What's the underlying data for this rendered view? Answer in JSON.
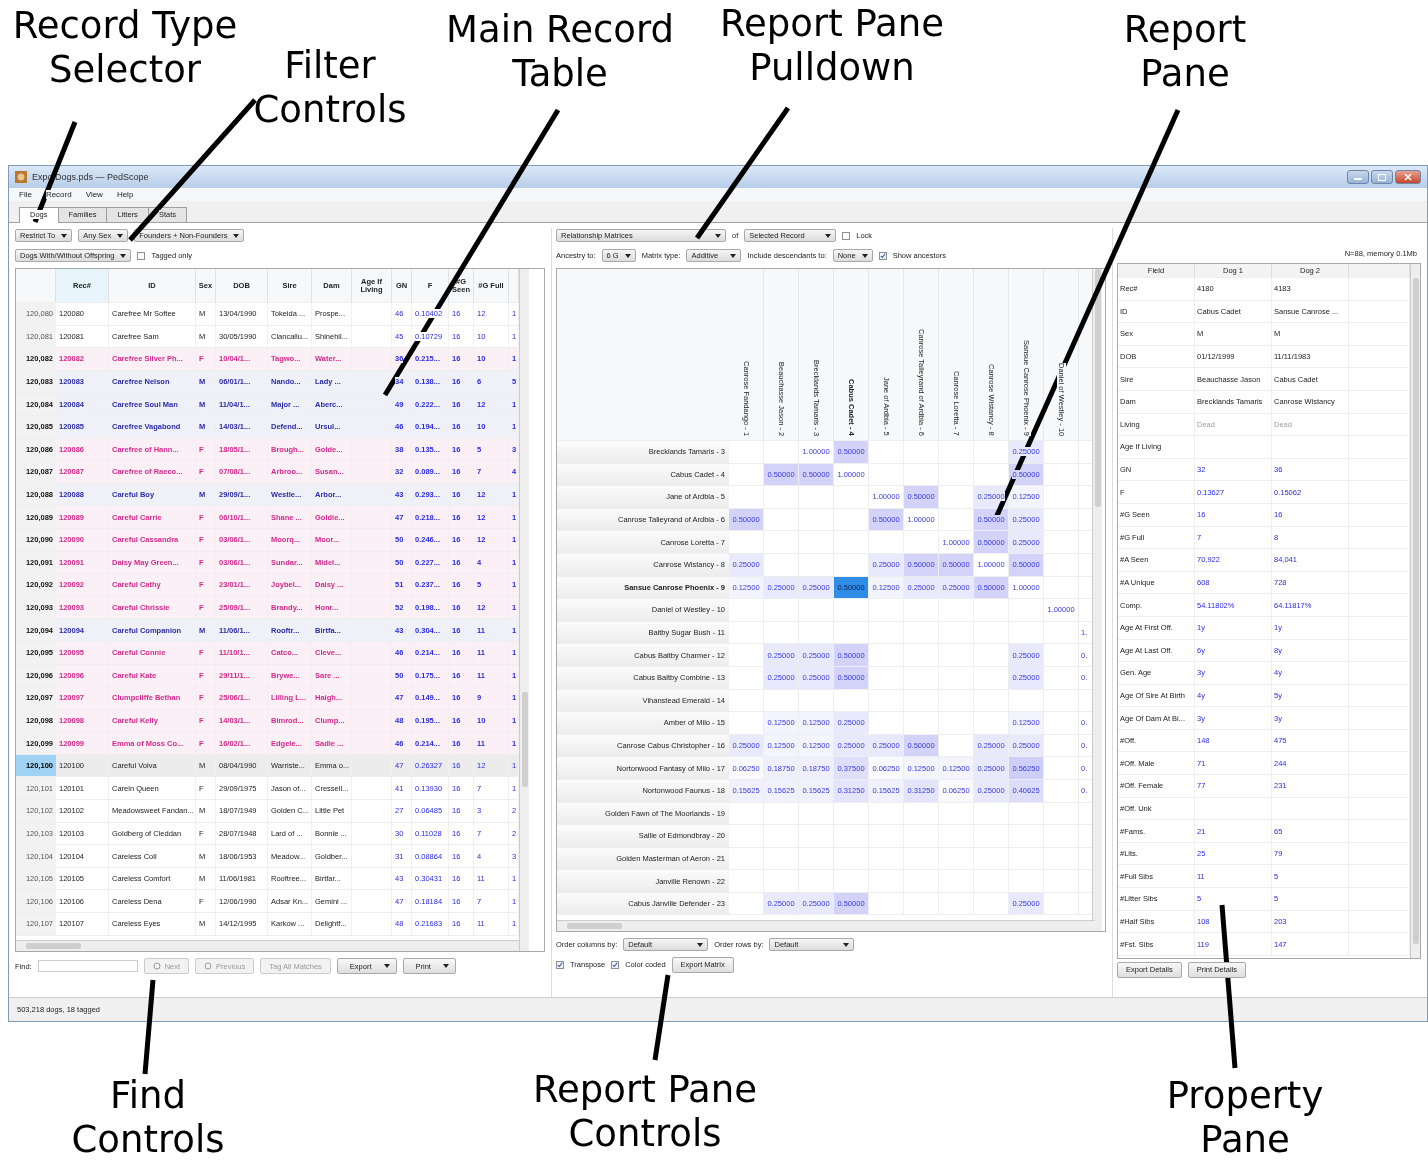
{
  "callouts": [
    {
      "lines": [
        "Record Type",
        "Selector"
      ]
    },
    {
      "lines": [
        "Filter",
        "Controls"
      ]
    },
    {
      "lines": [
        "Main Record",
        "Table"
      ]
    },
    {
      "lines": [
        "Report Pane",
        "Pulldown"
      ]
    },
    {
      "lines": [
        "Report",
        "Pane"
      ]
    },
    {
      "lines": [
        "Find",
        "Controls"
      ]
    },
    {
      "lines": [
        "Report Pane",
        "Controls"
      ]
    },
    {
      "lines": [
        "Property",
        "Pane"
      ]
    }
  ],
  "window": {
    "title": "Expo Dogs.pds — PedScope",
    "menu": [
      "File",
      "Record",
      "View",
      "Help"
    ]
  },
  "tabs": [
    {
      "label": "Dogs",
      "selected": true
    },
    {
      "label": "Families",
      "selected": false
    },
    {
      "label": "Litters",
      "selected": false
    },
    {
      "label": "Stats",
      "selected": false
    }
  ],
  "filters": {
    "dropdowns": [
      "Restrict To",
      "Any Sex",
      "Founders + Non-Founders",
      "Dogs With/Without Offspring"
    ],
    "tagged_only": {
      "label": "Tagged only",
      "checked": false
    }
  },
  "records": {
    "columns": [
      "Rec#",
      "ID",
      "Sex",
      "DOB",
      "Sire",
      "Dam",
      "Age If Living",
      "GN",
      "F",
      "#G Seen",
      "#G Full"
    ],
    "rows": [
      {
        "header": "120,080",
        "rec": "120080",
        "id": "Carefree Mr Softee",
        "sex": "M",
        "dob": "13/04/1990",
        "sire": "Tokeida ...",
        "dam": "Prospe...",
        "gn": "46",
        "f": "0.10402",
        "g_seen": "16",
        "g_full": "12",
        "column_13": "1",
        "tagged": false,
        "selected": false
      },
      {
        "header": "120,081",
        "rec": "120081",
        "id": "Carefree Sam",
        "sex": "M",
        "dob": "30/05/1990",
        "sire": "Clancallu...",
        "dam": "Shinehil...",
        "gn": "45",
        "f": "0.10729",
        "g_seen": "16",
        "g_full": "10",
        "column_13": "1",
        "tagged": false,
        "selected": false
      },
      {
        "header": "120,082",
        "rec": "120082",
        "id": "Carefree Silver Ph...",
        "sex": "F",
        "dob": "10/04/1...",
        "sire": "Tagwo...",
        "dam": "Water...",
        "gn": "36",
        "f": "0.215...",
        "g_seen": "16",
        "g_full": "10",
        "column_13": "1",
        "tagged": true,
        "selected": false,
        "color": "#d42a8c"
      },
      {
        "header": "120,083",
        "rec": "120083",
        "id": "Carefree Nelson",
        "sex": "M",
        "dob": "06/01/1...",
        "sire": "Nando...",
        "dam": "Lady ...",
        "gn": "34",
        "f": "0.138...",
        "g_seen": "16",
        "g_full": "6",
        "column_13": "5",
        "tagged": true,
        "selected": false,
        "color": "#2c2ca8"
      },
      {
        "header": "120,084",
        "rec": "120084",
        "id": "Carefree Soul Man",
        "sex": "M",
        "dob": "11/04/1...",
        "sire": "Major ...",
        "dam": "Aberc...",
        "gn": "49",
        "f": "0.222...",
        "g_seen": "16",
        "g_full": "12",
        "column_13": "1",
        "tagged": true,
        "selected": false,
        "color": "#2c2ca8"
      },
      {
        "header": "120,085",
        "rec": "120085",
        "id": "Carefree Vagabond",
        "sex": "M",
        "dob": "14/03/1...",
        "sire": "Defend...",
        "dam": "Ursul...",
        "gn": "46",
        "f": "0.194...",
        "g_seen": "16",
        "g_full": "10",
        "column_13": "1",
        "tagged": true,
        "selected": false,
        "color": "#2c2ca8"
      },
      {
        "header": "120,086",
        "rec": "120086",
        "id": "Carefree of Hann...",
        "sex": "F",
        "dob": "18/05/1...",
        "sire": "Brough...",
        "dam": "Golde...",
        "gn": "38",
        "f": "0.135...",
        "g_seen": "16",
        "g_full": "5",
        "column_13": "3",
        "tagged": true,
        "selected": false,
        "color": "#d42a8c"
      },
      {
        "header": "120,087",
        "rec": "120087",
        "id": "Carefree of Raeco...",
        "sex": "F",
        "dob": "07/08/1...",
        "sire": "Arbroo...",
        "dam": "Susan...",
        "gn": "32",
        "f": "0.089...",
        "g_seen": "16",
        "g_full": "7",
        "column_13": "4",
        "tagged": true,
        "selected": false,
        "color": "#d42a8c"
      },
      {
        "header": "120,088",
        "rec": "120088",
        "id": "Careful Boy",
        "sex": "M",
        "dob": "29/09/1...",
        "sire": "Westle...",
        "dam": "Arbor...",
        "gn": "43",
        "f": "0.293...",
        "g_seen": "16",
        "g_full": "12",
        "column_13": "1",
        "tagged": true,
        "selected": false,
        "color": "#2c2ca8"
      },
      {
        "header": "120,089",
        "rec": "120089",
        "id": "Careful Carrie",
        "sex": "F",
        "dob": "06/10/1...",
        "sire": "Shane ...",
        "dam": "Goldie...",
        "gn": "47",
        "f": "0.218...",
        "g_seen": "16",
        "g_full": "12",
        "column_13": "1",
        "tagged": true,
        "selected": false,
        "color": "#d42a8c"
      },
      {
        "header": "120,090",
        "rec": "120090",
        "id": "Careful Cassandra",
        "sex": "F",
        "dob": "03/06/1...",
        "sire": "Moorq...",
        "dam": "Moor...",
        "gn": "50",
        "f": "0.246...",
        "g_seen": "16",
        "g_full": "12",
        "column_13": "1",
        "tagged": true,
        "selected": false,
        "color": "#d42a8c"
      },
      {
        "header": "120,091",
        "rec": "120091",
        "id": "Daisy May Green...",
        "sex": "F",
        "dob": "03/06/1...",
        "sire": "Sundar...",
        "dam": "Midel...",
        "gn": "50",
        "f": "0.227...",
        "g_seen": "16",
        "g_full": "4",
        "column_13": "1",
        "tagged": true,
        "selected": false,
        "color": "#d42a8c"
      },
      {
        "header": "120,092",
        "rec": "120092",
        "id": "Careful Cathy",
        "sex": "F",
        "dob": "23/01/1...",
        "sire": "Joybel...",
        "dam": "Daisy ...",
        "gn": "51",
        "f": "0.237...",
        "g_seen": "16",
        "g_full": "5",
        "column_13": "1",
        "tagged": true,
        "selected": false,
        "color": "#d42a8c"
      },
      {
        "header": "120,093",
        "rec": "120093",
        "id": "Careful Chrissie",
        "sex": "F",
        "dob": "25/09/1...",
        "sire": "Brandy...",
        "dam": "Honr...",
        "gn": "52",
        "f": "0.198...",
        "g_seen": "16",
        "g_full": "12",
        "column_13": "1",
        "tagged": true,
        "selected": false,
        "color": "#d42a8c"
      },
      {
        "header": "120,094",
        "rec": "120094",
        "id": "Careful Companion",
        "sex": "M",
        "dob": "11/06/1...",
        "sire": "Rooftr...",
        "dam": "Birtfa...",
        "gn": "43",
        "f": "0.304...",
        "g_seen": "16",
        "g_full": "11",
        "column_13": "1",
        "tagged": true,
        "selected": false,
        "color": "#2c2ca8"
      },
      {
        "header": "120,095",
        "rec": "120095",
        "id": "Careful Connie",
        "sex": "F",
        "dob": "11/10/1...",
        "sire": "Catco...",
        "dam": "Cleve...",
        "gn": "46",
        "f": "0.214...",
        "g_seen": "16",
        "g_full": "11",
        "column_13": "1",
        "tagged": true,
        "selected": false,
        "color": "#d42a8c"
      },
      {
        "header": "120,096",
        "rec": "120096",
        "id": "Careful Kate",
        "sex": "F",
        "dob": "29/11/1...",
        "sire": "Brywe...",
        "dam": "Sare ...",
        "gn": "50",
        "f": "0.175...",
        "g_seen": "16",
        "g_full": "11",
        "column_13": "1",
        "tagged": true,
        "selected": false,
        "color": "#d42a8c"
      },
      {
        "header": "120,097",
        "rec": "120097",
        "id": "Clumpcliffe Bethan",
        "sex": "F",
        "dob": "25/06/1...",
        "sire": "Lilling L...",
        "dam": "Haigh...",
        "gn": "47",
        "f": "0.149...",
        "g_seen": "16",
        "g_full": "9",
        "column_13": "1",
        "tagged": true,
        "selected": false,
        "color": "#d42a8c"
      },
      {
        "header": "120,098",
        "rec": "120098",
        "id": "Careful Kelly",
        "sex": "F",
        "dob": "14/03/1...",
        "sire": "Bimrod...",
        "dam": "Clump...",
        "gn": "48",
        "f": "0.195...",
        "g_seen": "16",
        "g_full": "10",
        "column_13": "1",
        "tagged": true,
        "selected": false,
        "color": "#d42a8c"
      },
      {
        "header": "120,099",
        "rec": "120099",
        "id": "Emma of Moss Co...",
        "sex": "F",
        "dob": "16/02/1...",
        "sire": "Edgele...",
        "dam": "Sadie ...",
        "gn": "46",
        "f": "0.214...",
        "g_seen": "16",
        "g_full": "11",
        "column_13": "1",
        "tagged": true,
        "selected": false,
        "color": "#d42a8c"
      },
      {
        "header": "120,100",
        "rec": "120100",
        "id": "Careful Volva",
        "sex": "M",
        "dob": "08/04/1990",
        "sire": "Warriste...",
        "dam": "Emma o...",
        "gn": "47",
        "f": "0.26327",
        "g_seen": "16",
        "g_full": "12",
        "column_13": "1",
        "tagged": false,
        "selected": true
      },
      {
        "header": "120,101",
        "rec": "120101",
        "id": "Carein Queen",
        "sex": "F",
        "dob": "29/09/1975",
        "sire": "Jason of...",
        "dam": "Cressell...",
        "gn": "41",
        "f": "0.13930",
        "g_seen": "16",
        "g_full": "7",
        "column_13": "1",
        "tagged": false,
        "selected": false
      },
      {
        "header": "120,102",
        "rec": "120102",
        "id": "Meadowsweet Fandan...",
        "sex": "M",
        "dob": "18/07/1949",
        "sire": "Golden C...",
        "dam": "Little Pet",
        "gn": "27",
        "f": "0.06485",
        "g_seen": "16",
        "g_full": "3",
        "column_13": "2",
        "tagged": false,
        "selected": false
      },
      {
        "header": "120,103",
        "rec": "120103",
        "id": "Goldberg of Cleddan",
        "sex": "F",
        "dob": "28/07/1948",
        "sire": "Lard of ...",
        "dam": "Bonnie ...",
        "gn": "30",
        "f": "0.11028",
        "g_seen": "16",
        "g_full": "7",
        "column_13": "2",
        "tagged": false,
        "selected": false
      },
      {
        "header": "120,104",
        "rec": "120104",
        "id": "Careless Coll",
        "sex": "M",
        "dob": "18/06/1953",
        "sire": "Meadow...",
        "dam": "Goldber...",
        "gn": "31",
        "f": "0.08864",
        "g_seen": "16",
        "g_full": "4",
        "column_13": "3",
        "tagged": false,
        "selected": false
      },
      {
        "header": "120,105",
        "rec": "120105",
        "id": "Careless Comfort",
        "sex": "M",
        "dob": "11/06/1981",
        "sire": "Rooftree...",
        "dam": "Birtfar...",
        "gn": "43",
        "f": "0.30431",
        "g_seen": "16",
        "g_full": "11",
        "column_13": "1",
        "tagged": false,
        "selected": false
      },
      {
        "header": "120,106",
        "rec": "120106",
        "id": "Careless Dena",
        "sex": "F",
        "dob": "12/06/1990",
        "sire": "Adsar Kn...",
        "dam": "Gemini ...",
        "gn": "47",
        "f": "0.18184",
        "g_seen": "16",
        "g_full": "7",
        "column_13": "1",
        "tagged": false,
        "selected": false
      },
      {
        "header": "120,107",
        "rec": "120107",
        "id": "Careless Eyes",
        "sex": "M",
        "dob": "14/12/1995",
        "sire": "Karkow ...",
        "dam": "Delightf...",
        "gn": "48",
        "f": "0.21683",
        "g_seen": "16",
        "g_full": "11",
        "column_13": "1",
        "tagged": false,
        "selected": false
      }
    ]
  },
  "find": {
    "label": "Find:",
    "buttons": [
      {
        "label": "Next",
        "kind": "icon",
        "disabled": true
      },
      {
        "label": "Previous",
        "kind": "icon",
        "disabled": true
      },
      {
        "label": "Tag All Matches",
        "kind": "plain",
        "disabled": true
      },
      {
        "label": "Export",
        "kind": "menu",
        "disabled": false
      },
      {
        "label": "Print",
        "kind": "menu",
        "disabled": false
      }
    ]
  },
  "status_bar": "503,218 dogs, 18 tagged",
  "report": {
    "pulldown": "Relationship Matrices",
    "of_label": "of",
    "target": "Selected Record",
    "lock": {
      "label": "Lock",
      "checked": false
    },
    "ancestry_label": "Ancestry to:",
    "ancestry": "6 G",
    "matrix_type_label": "Matrix type:",
    "matrix_type": "Additive",
    "descendants_label": "Include descendants to:",
    "descendants": "None",
    "show_ancestors": {
      "label": "Show ancestors",
      "checked": true
    }
  },
  "matrix": {
    "columns": [
      {
        "name": "Canrose Fandango - 1",
        "selected": false
      },
      {
        "name": "Beauchasse Jason - 2",
        "selected": false
      },
      {
        "name": "Brecklands Tamaris - 3",
        "selected": false
      },
      {
        "name": "Cabus Cadet - 4",
        "selected": true
      },
      {
        "name": "Jane of Ardbia - 5",
        "selected": false
      },
      {
        "name": "Canrose Talleyrand of Ardbia - 6",
        "selected": false
      },
      {
        "name": "Canrose Loretta - 7",
        "selected": false
      },
      {
        "name": "Canrose Wistancy - 8",
        "selected": false
      },
      {
        "name": "Sansue Canrose Phoenix - 9",
        "selected": false
      },
      {
        "name": "Daniel of Westley - 10",
        "selected": false
      }
    ],
    "rows": [
      {
        "name": "Brecklands Tamaris - 3",
        "selected": false,
        "cells": [
          null,
          null,
          "1.00000",
          "0.50000",
          null,
          null,
          null,
          null,
          "0.25000",
          null,
          null
        ]
      },
      {
        "name": "Cabus Cadet - 4",
        "selected": false,
        "cells": [
          null,
          "0.50000",
          "0.50000",
          "1.00000",
          null,
          null,
          null,
          null,
          "0.50000",
          null,
          null
        ]
      },
      {
        "name": "Jane of Ardbia - 5",
        "selected": false,
        "cells": [
          null,
          null,
          null,
          null,
          "1.00000",
          "0.50000",
          null,
          "0.25000",
          "0.12500",
          null,
          null
        ]
      },
      {
        "name": "Canrose Talleyrand of Ardbia - 6",
        "selected": false,
        "cells": [
          "0.50000",
          null,
          null,
          null,
          "0.50000",
          "1.00000",
          null,
          "0.50000",
          "0.25000",
          null,
          null
        ]
      },
      {
        "name": "Canrose Loretta - 7",
        "selected": false,
        "cells": [
          null,
          null,
          null,
          null,
          null,
          null,
          "1.00000",
          "0.50000",
          "0.25000",
          null,
          null
        ]
      },
      {
        "name": "Canrose Wistancy - 8",
        "selected": false,
        "cells": [
          "0.25000",
          null,
          null,
          null,
          "0.25000",
          "0.50000",
          "0.50000",
          "1.00000",
          "0.50000",
          null,
          null
        ]
      },
      {
        "name": "Sansue Canrose Phoenix - 9",
        "selected": true,
        "cells": [
          "0.12500",
          "0.25000",
          "0.25000",
          "0.50000",
          "0.12500",
          "0.25000",
          "0.25000",
          "0.50000",
          "1.00000",
          null,
          null
        ]
      },
      {
        "name": "Daniel of Westley - 10",
        "selected": false,
        "cells": [
          null,
          null,
          null,
          null,
          null,
          null,
          null,
          null,
          null,
          "1.00000",
          null
        ]
      },
      {
        "name": "Baltby Sugar Bush - 11",
        "selected": false,
        "cells": [
          null,
          null,
          null,
          null,
          null,
          null,
          null,
          null,
          null,
          null,
          "1."
        ]
      },
      {
        "name": "Cabus Baltby Charmer - 12",
        "selected": false,
        "cells": [
          null,
          "0.25000",
          "0.25000",
          "0.50000",
          null,
          null,
          null,
          null,
          "0.25000",
          null,
          "0."
        ]
      },
      {
        "name": "Cabus Baltby Combine - 13",
        "selected": false,
        "cells": [
          null,
          "0.25000",
          "0.25000",
          "0.50000",
          null,
          null,
          null,
          null,
          "0.25000",
          null,
          "0."
        ]
      },
      {
        "name": "Vihanstead Emerald - 14",
        "selected": false,
        "cells": [
          null,
          null,
          null,
          null,
          null,
          null,
          null,
          null,
          null,
          null,
          null
        ]
      },
      {
        "name": "Amber of Milo - 15",
        "selected": false,
        "cells": [
          null,
          "0.12500",
          "0.12500",
          "0.25000",
          null,
          null,
          null,
          null,
          "0.12500",
          null,
          "0."
        ]
      },
      {
        "name": "Canrose Cabus Christopher - 16",
        "selected": false,
        "cells": [
          "0.25000",
          "0.12500",
          "0.12500",
          "0.25000",
          "0.25000",
          "0.50000",
          null,
          "0.25000",
          "0.25000",
          null,
          "0."
        ]
      },
      {
        "name": "Nortonwood Fantasy of Milo - 17",
        "selected": false,
        "cells": [
          "0.06250",
          "0.18750",
          "0.18750",
          "0.37500",
          "0.06250",
          "0.12500",
          "0.12500",
          "0.25000",
          "0.56250",
          null,
          "0."
        ]
      },
      {
        "name": "Nortonwood Faunus - 18",
        "selected": false,
        "cells": [
          "0.15625",
          "0.15625",
          "0.15625",
          "0.31250",
          "0.15625",
          "0.31250",
          "0.06250",
          "0.25000",
          "0.40625",
          null,
          "0."
        ]
      },
      {
        "name": "Golden Fawn of The Moorlands - 19",
        "selected": false,
        "cells": [
          null,
          null,
          null,
          null,
          null,
          null,
          null,
          null,
          null,
          null,
          null
        ]
      },
      {
        "name": "Sallie of Edmondbray - 20",
        "selected": false,
        "cells": [
          null,
          null,
          null,
          null,
          null,
          null,
          null,
          null,
          null,
          null,
          null
        ]
      },
      {
        "name": "Golden Masterman of Aeron - 21",
        "selected": false,
        "cells": [
          null,
          null,
          null,
          null,
          null,
          null,
          null,
          null,
          null,
          null,
          null
        ]
      },
      {
        "name": "Janville Renown - 22",
        "selected": false,
        "cells": [
          null,
          null,
          null,
          null,
          null,
          null,
          null,
          null,
          null,
          null,
          null
        ]
      },
      {
        "name": "Cabus Janville Defender - 23",
        "selected": false,
        "cells": [
          null,
          "0.25000",
          "0.25000",
          "0.50000",
          null,
          null,
          null,
          null,
          "0.25000",
          null,
          null
        ]
      }
    ]
  },
  "matrix_controls": {
    "order_columns_label": "Order columns by:",
    "order_columns": "Default",
    "order_rows_label": "Order rows by:",
    "order_rows": "Default",
    "transpose": {
      "label": "Transpose",
      "checked": true
    },
    "color_coded": {
      "label": "Color coded",
      "checked": true
    },
    "export_button": "Export Matrix"
  },
  "memory_info": "N=88, memory 0.1Mb",
  "properties": {
    "columns": [
      "Field",
      "Dog 1",
      "Dog 2"
    ],
    "rows": [
      {
        "field": "Rec#",
        "dog_1": "4180",
        "dog_2": "4183",
        "kind": "text"
      },
      {
        "field": "ID",
        "dog_1": "Cabus Cadet",
        "dog_2": "Sansue Canrose ...",
        "kind": "text"
      },
      {
        "field": "Sex",
        "dog_1": "M",
        "dog_2": "M",
        "kind": "text"
      },
      {
        "field": "DOB",
        "dog_1": "01/12/1999",
        "dog_2": "11/11/1983",
        "kind": "text"
      },
      {
        "field": "Sire",
        "dog_1": "Beauchasse Jason",
        "dog_2": "Cabus Cadet",
        "kind": "text"
      },
      {
        "field": "Dam",
        "dog_1": "Brecklands Tamaris",
        "dog_2": "Canrose Wistancy",
        "kind": "text"
      },
      {
        "field": "Living",
        "dog_1": "Dead",
        "dog_2": "Dead",
        "kind": "muted"
      },
      {
        "field": "Age If Living",
        "kind": "text"
      },
      {
        "field": "GN",
        "dog_1": "32",
        "dog_2": "36",
        "kind": "number"
      },
      {
        "field": "F",
        "dog_1": "0.13627",
        "dog_2": "0.15062",
        "kind": "number"
      },
      {
        "field": "#G Seen",
        "dog_1": "16",
        "dog_2": "16",
        "kind": "number"
      },
      {
        "field": "#G Full",
        "dog_1": "7",
        "dog_2": "8",
        "kind": "number"
      },
      {
        "field": "#A Seen",
        "dog_1": "70,922",
        "dog_2": "84,041",
        "kind": "number"
      },
      {
        "field": "#A Unique",
        "dog_1": "608",
        "dog_2": "728",
        "kind": "number"
      },
      {
        "field": "Comp.",
        "dog_1": "54.11802%",
        "dog_2": "64.11817%",
        "kind": "number"
      },
      {
        "field": "Age At First Off.",
        "dog_1": "1y",
        "dog_2": "1y",
        "kind": "number"
      },
      {
        "field": "Age At Last Off.",
        "dog_1": "6y",
        "dog_2": "8y",
        "kind": "number"
      },
      {
        "field": "Gen. Age",
        "dog_1": "3y",
        "dog_2": "4y",
        "kind": "number"
      },
      {
        "field": "Age Of Sire At Birth",
        "dog_1": "4y",
        "dog_2": "5y",
        "kind": "number"
      },
      {
        "field": "Age Of Dam At Bi...",
        "dog_1": "3y",
        "dog_2": "3y",
        "kind": "number"
      },
      {
        "field": "#Off.",
        "dog_1": "148",
        "dog_2": "475",
        "kind": "number"
      },
      {
        "field": "#Off. Male",
        "dog_1": "71",
        "dog_2": "244",
        "kind": "number"
      },
      {
        "field": "#Off. Female",
        "dog_1": "77",
        "dog_2": "231",
        "kind": "number"
      },
      {
        "field": "#Off. Unk",
        "kind": "number"
      },
      {
        "field": "#Fams.",
        "dog_1": "21",
        "dog_2": "65",
        "kind": "number"
      },
      {
        "field": "#Lits.",
        "dog_1": "25",
        "dog_2": "79",
        "kind": "number"
      },
      {
        "field": "#Full Sibs",
        "dog_1": "11",
        "dog_2": "5",
        "kind": "number"
      },
      {
        "field": "#Litter Sibs",
        "dog_1": "5",
        "dog_2": "5",
        "kind": "number"
      },
      {
        "field": "#Half Sibs",
        "dog_1": "108",
        "dog_2": "203",
        "kind": "number"
      },
      {
        "field": "#Fst. Sibs",
        "dog_1": "119",
        "dog_2": "147",
        "kind": "number"
      }
    ],
    "buttons": [
      "Export Details",
      "Print Details"
    ]
  }
}
